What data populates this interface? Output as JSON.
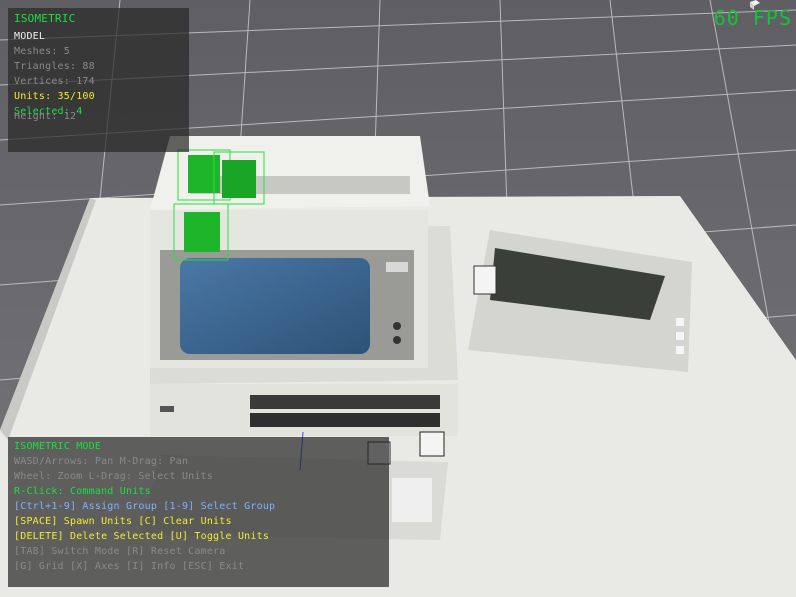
{
  "hud": {
    "mode_title": "ISOMETRIC",
    "model_label": "MODEL",
    "meshes": "Meshes: 5",
    "triangles": "Triangles: 88",
    "vertices": "Vertices: 174",
    "units": "Units: 35/100",
    "selected": "Selected: 4",
    "height": "Height: 12"
  },
  "fps": "60 FPS",
  "controls": {
    "title": "ISOMETRIC MODE",
    "lines": [
      "WASD/Arrows: Pan  M-Drag: Pan",
      "Wheel: Zoom  L-Drag: Select Units",
      "R-Click: Command Units",
      "[Ctrl+1-9] Assign Group  [1-9] Select Group",
      "[SPACE] Spawn Units  [C] Clear Units",
      "[DELETE] Delete Selected  [U] Toggle Units",
      "[TAB] Switch Mode  [R] Reset Camera",
      "[G] Grid  [X] Axes  [I] Info  [ESC] Exit"
    ]
  },
  "colors": {
    "hud_green": "#19e043",
    "hud_yellow": "#f4ec2a",
    "hud_blue": "#7fb2ff",
    "unit_green": "#1fb52b",
    "grid_line": "#c8c8c8",
    "ground": "#6e6e72"
  },
  "icons": {
    "fps_icon": "perf-cube-icon"
  }
}
